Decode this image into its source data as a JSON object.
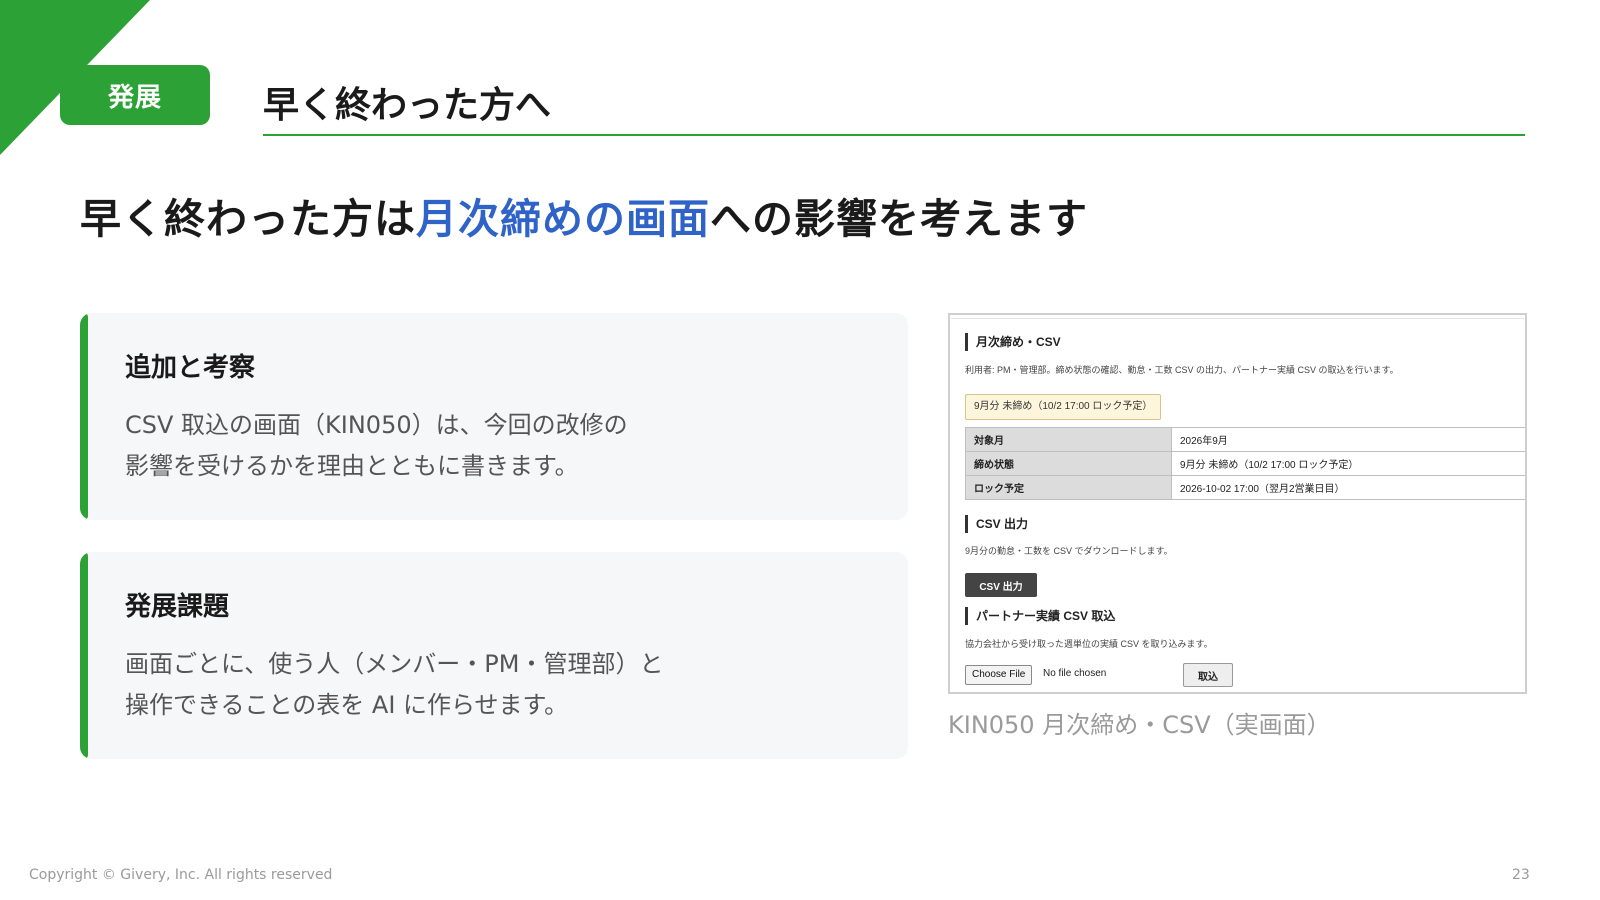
{
  "header": {
    "badge": "発展",
    "title": "早く終わった方へ"
  },
  "headline": {
    "before": "早く終わった方は",
    "highlight": "月次締めの画面",
    "after": "への影響を考えます"
  },
  "cards": [
    {
      "title": "追加と考察",
      "lines": [
        "CSV 取込の画面（KIN050）は、今回の改修の",
        "影響を受けるかを理由とともに書きます。"
      ]
    },
    {
      "title": "発展課題",
      "lines": [
        "画面ごとに、使う人（メンバー・PM・管理部）と",
        "操作できることの表を AI に作らせます。"
      ]
    }
  ],
  "screenshot": {
    "title": "月次締め・CSV",
    "description": "利用者: PM・管理部。締め状態の確認、勤怠・工数 CSV の出力、パートナー実績 CSV の取込を行います。",
    "status_chip": "9月分 未締め（10/2 17:00 ロック予定）",
    "table": [
      {
        "label": "対象月",
        "value": "2026年9月"
      },
      {
        "label": "締め状態",
        "value": "9月分 未締め（10/2 17:00 ロック予定）"
      },
      {
        "label": "ロック予定",
        "value": "2026-10-02 17:00（翌月2営業日目）"
      }
    ],
    "csv_output": {
      "title": "CSV 出力",
      "description": "9月分の勤怠・工数を CSV でダウンロードします。",
      "button": "CSV 出力"
    },
    "partner_import": {
      "title": "パートナー実績 CSV 取込",
      "description": "協力会社から受け取った週単位の実績 CSV を取り込みます。",
      "file_button": "Choose File",
      "file_status": "No file chosen",
      "import_button": "取込"
    }
  },
  "caption": "KIN050 月次締め・CSV（実画面）",
  "footer": {
    "copyright": "Copyright © Givery, Inc. All rights reserved",
    "page": "23"
  },
  "colors": {
    "accent_green": "#2ca236",
    "highlight_blue": "#2f63c8"
  }
}
